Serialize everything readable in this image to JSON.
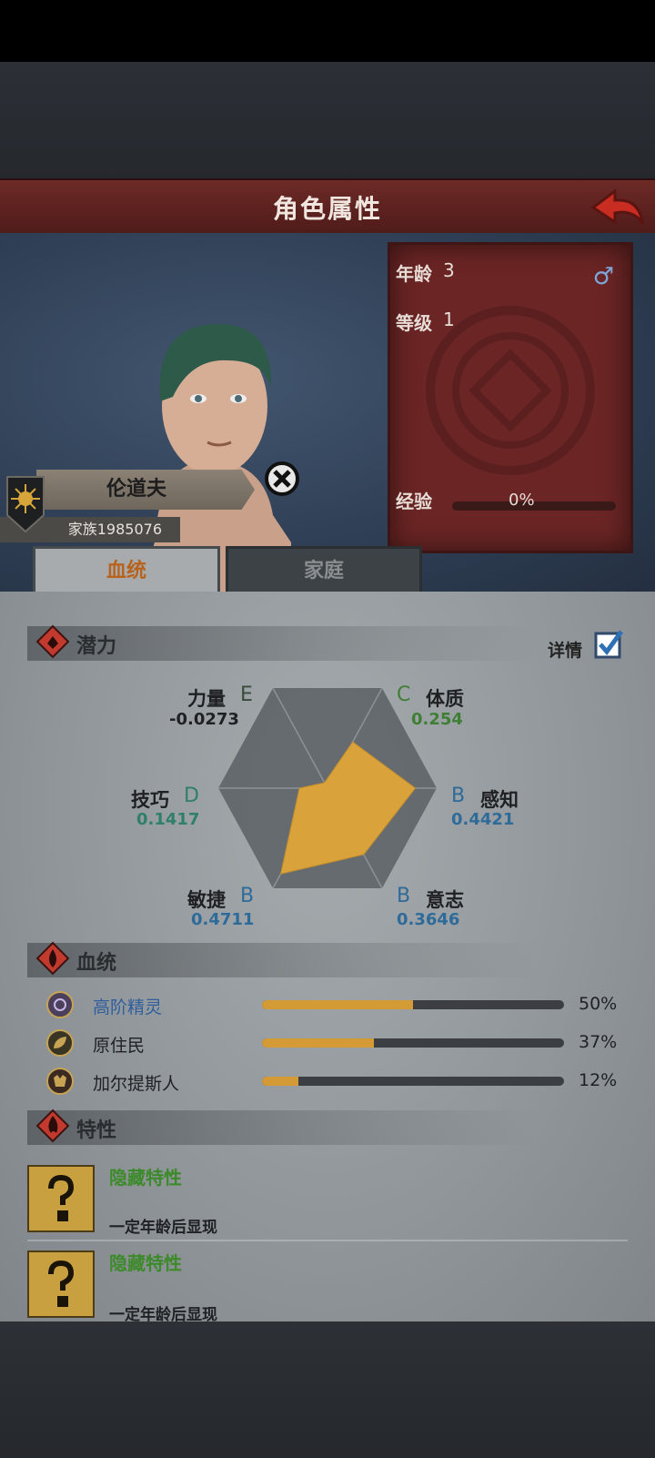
{
  "header": {
    "title": "角色属性"
  },
  "character": {
    "name": "伦道夫",
    "family": "家族1985076",
    "age_label": "年龄",
    "age": "3",
    "gender": "♂",
    "level_label": "等级",
    "level": "1",
    "exp_label": "经验",
    "exp": "0%"
  },
  "tabs": [
    {
      "label": "血统"
    },
    {
      "label": "家庭"
    }
  ],
  "potential": {
    "title": "潜力",
    "detail_label": "详情",
    "detail_checked": true,
    "stats": [
      {
        "name": "力量",
        "grade": "E",
        "value": "-0.0273",
        "color": "#3a4a3d"
      },
      {
        "name": "体质",
        "grade": "C",
        "value": "0.254",
        "color": "#3f7f35"
      },
      {
        "name": "感知",
        "grade": "B",
        "value": "0.4421",
        "color": "#2f6b99"
      },
      {
        "name": "意志",
        "grade": "B",
        "value": "0.3646",
        "color": "#2f6b99"
      },
      {
        "name": "敏捷",
        "grade": "B",
        "value": "0.4711",
        "color": "#2f6b99"
      },
      {
        "name": "技巧",
        "grade": "D",
        "value": "0.1417",
        "color": "#2f7f6a"
      }
    ]
  },
  "bloodline": {
    "title": "血统",
    "items": [
      {
        "name": "高阶精灵",
        "percent": "50%",
        "fill": 0.5,
        "icon": "elf-icon",
        "name_color": "#2f5e9c"
      },
      {
        "name": "原住民",
        "percent": "37%",
        "fill": 0.37,
        "icon": "leaf-icon",
        "name_color": "#1f2124"
      },
      {
        "name": "加尔提斯人",
        "percent": "12%",
        "fill": 0.12,
        "icon": "beast-icon",
        "name_color": "#1f2124"
      }
    ]
  },
  "traits": {
    "title": "特性",
    "items": [
      {
        "name": "隐藏特性",
        "desc": "一定年龄后显现"
      },
      {
        "name": "隐藏特性",
        "desc": "一定年龄后显现"
      }
    ]
  }
}
